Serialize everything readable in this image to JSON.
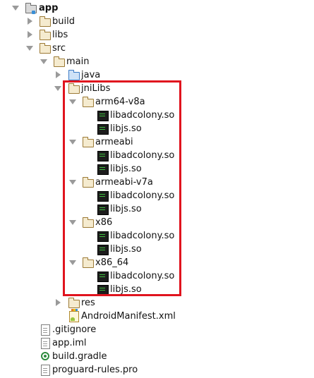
{
  "project_tree": {
    "root": {
      "label": "app"
    },
    "build": {
      "label": "build"
    },
    "libs": {
      "label": "libs"
    },
    "src": {
      "label": "src"
    },
    "main": {
      "label": "main"
    },
    "java": {
      "label": "java"
    },
    "jniLibs": {
      "label": "jniLibs"
    },
    "abis": [
      {
        "label": "arm64-v8a",
        "files": [
          "libadcolony.so",
          "libjs.so"
        ]
      },
      {
        "label": "armeabi",
        "files": [
          "libadcolony.so",
          "libjs.so"
        ]
      },
      {
        "label": "armeabi-v7a",
        "files": [
          "libadcolony.so",
          "libjs.so"
        ]
      },
      {
        "label": "x86",
        "files": [
          "libadcolony.so",
          "libjs.so"
        ]
      },
      {
        "label": "x86_64",
        "files": [
          "libadcolony.so",
          "libjs.so"
        ]
      }
    ],
    "res": {
      "label": "res"
    },
    "manifest": {
      "label": "AndroidManifest.xml"
    },
    "gitignore": {
      "label": ".gitignore"
    },
    "app_iml": {
      "label": "app.iml"
    },
    "build_gradle": {
      "label": "build.gradle"
    },
    "proguard": {
      "label": "proguard-rules.pro"
    }
  },
  "colors": {
    "highlight_box": "#e0141e"
  }
}
